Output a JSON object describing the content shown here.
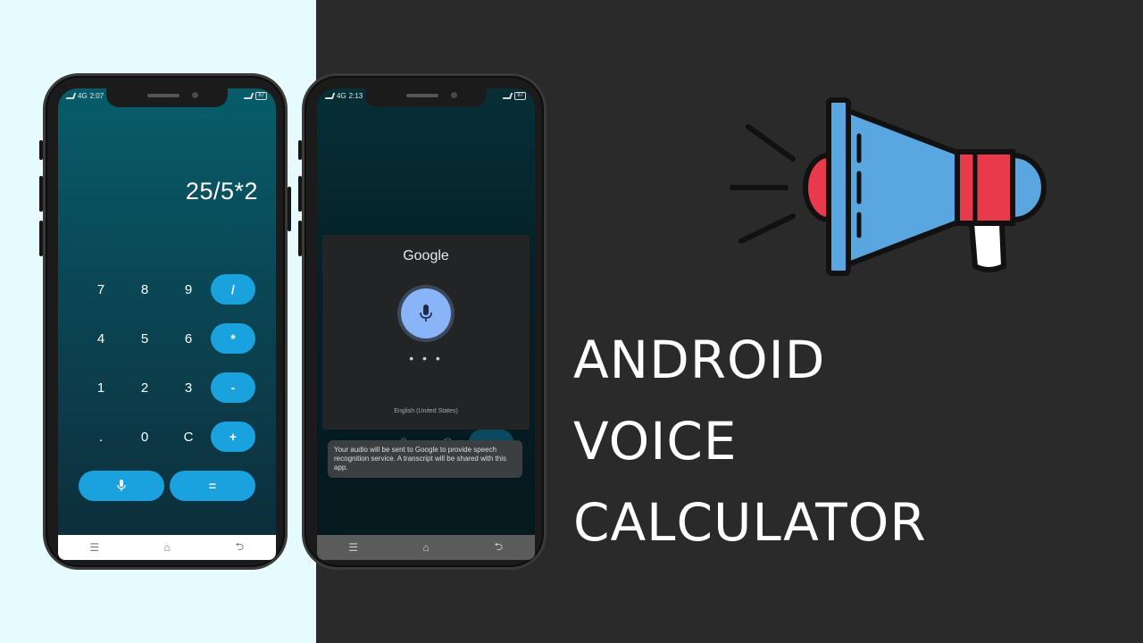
{
  "phone1": {
    "status": {
      "time": "2:07",
      "signal": "4G",
      "battery": "87"
    },
    "display": {
      "expression": "25/5*2"
    },
    "keys": {
      "row1": [
        "7",
        "8",
        "9"
      ],
      "row2": [
        "4",
        "5",
        "6"
      ],
      "row3": [
        "1",
        "2",
        "3"
      ],
      "row4": [
        ".",
        "0",
        "C"
      ],
      "ops": [
        "/",
        "*",
        "-",
        "+"
      ],
      "equals": "="
    },
    "nav": {
      "menu": "☰",
      "home": "⌂",
      "back": "⮌"
    }
  },
  "phone2": {
    "status": {
      "time": "2:13",
      "signal": "4G",
      "battery": "87"
    },
    "google_dialog": {
      "logo": "Google",
      "listening": "• • •",
      "language": "English (United States)"
    },
    "behind_keys": {
      "dot": ".",
      "zero": "0",
      "clear": "C",
      "plus": "+"
    },
    "toast": "Your audio will be sent to Google to provide speech recognition service. A transcript will be shared with this app.",
    "nav": {
      "menu": "☰",
      "home": "⌂",
      "back": "⮌"
    }
  },
  "headline": {
    "line1": "ANDROID",
    "line2": "VOICE",
    "line3": "CALCULATOR"
  },
  "icons": [
    "megaphone-icon",
    "mic-icon",
    "menu-icon",
    "home-icon",
    "back-icon"
  ],
  "colors": {
    "left_bg": "#e6fbfd",
    "right_bg": "#2a2a2a",
    "accent_button": "#1aa2df",
    "megaphone_blue": "#5aa6e0",
    "megaphone_red": "#e83a4a",
    "google_mic": "#8ab4f8"
  }
}
